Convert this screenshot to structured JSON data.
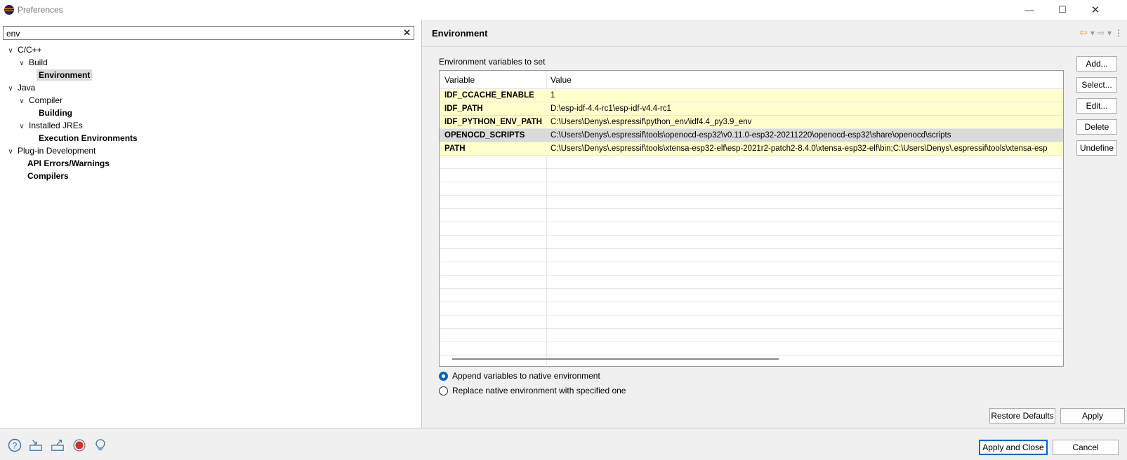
{
  "window": {
    "title": "Preferences"
  },
  "search": {
    "value": "env"
  },
  "tree": {
    "items": [
      {
        "label": "C/C++"
      },
      {
        "label": "Build"
      },
      {
        "label": "Environment"
      },
      {
        "label": "Java"
      },
      {
        "label": "Compiler"
      },
      {
        "label": "Building"
      },
      {
        "label": "Installed JREs"
      },
      {
        "label": "Execution Environments"
      },
      {
        "label": "Plug-in Development"
      },
      {
        "label": "API Errors/Warnings"
      },
      {
        "label": "Compilers"
      }
    ]
  },
  "page": {
    "title": "Environment",
    "group_label": "Environment variables to set",
    "table": {
      "headers": [
        "Variable",
        "Value"
      ],
      "rows": [
        {
          "variable": "IDF_CCACHE_ENABLE",
          "value": "1"
        },
        {
          "variable": "IDF_PATH",
          "value": "D:\\esp-idf-4.4-rc1\\esp-idf-v4.4-rc1"
        },
        {
          "variable": "IDF_PYTHON_ENV_PATH",
          "value": "C:\\Users\\Denys\\.espressif\\python_env\\idf4.4_py3.9_env"
        },
        {
          "variable": "OPENOCD_SCRIPTS",
          "value": "C:\\Users\\Denys\\.espressif\\tools\\openocd-esp32\\v0.11.0-esp32-20211220\\openocd-esp32\\share\\openocd\\scripts"
        },
        {
          "variable": "PATH",
          "value": "C:\\Users\\Denys\\.espressif\\tools\\xtensa-esp32-elf\\esp-2021r2-patch2-8.4.0\\xtensa-esp32-elf\\bin;C:\\Users\\Denys\\.espressif\\tools\\xtensa-esp"
        }
      ]
    },
    "buttons": {
      "add": "Add...",
      "select": "Select...",
      "edit": "Edit...",
      "delete": "Delete",
      "undefine": "Undefine"
    },
    "radio": {
      "append": "Append variables to native environment",
      "replace": "Replace native environment with specified one",
      "selected": "append"
    },
    "restore_defaults": "Restore Defaults",
    "apply": "Apply"
  },
  "footer": {
    "apply_and_close": "Apply and Close",
    "cancel": "Cancel"
  },
  "colors": {
    "filled_row": "#ffffcc",
    "selected": "#dadada",
    "accent": "#0067c0"
  }
}
